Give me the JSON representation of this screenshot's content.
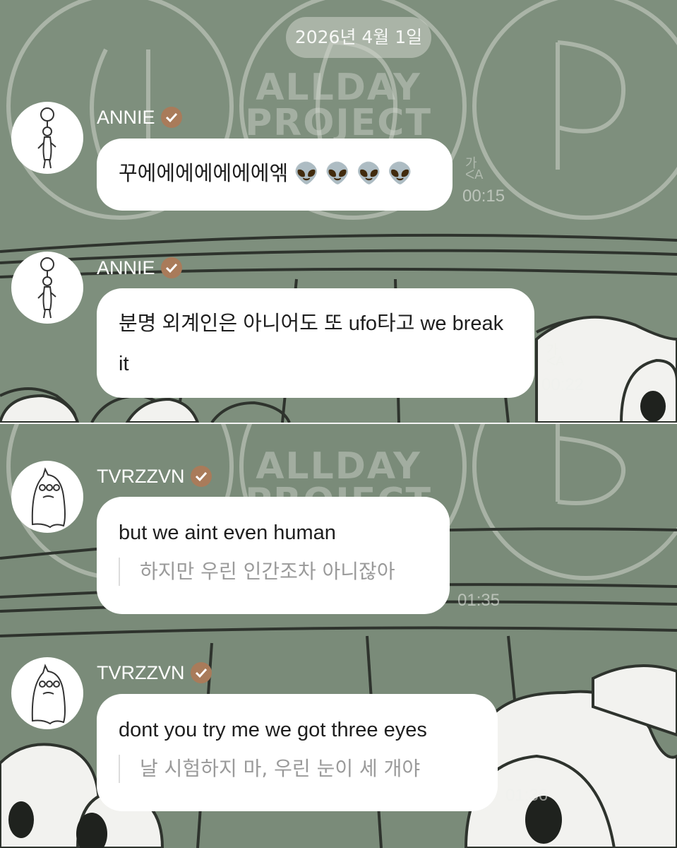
{
  "date": "2026년 4월 1일",
  "watermark": {
    "line1": "ALLDAY",
    "line2": "PROJECT"
  },
  "icons": {
    "verified": "verified-check-icon",
    "translate": "translate-icon"
  },
  "colors": {
    "background": "#7e8f7d",
    "bubble": "#ffffff",
    "verified_badge": "#a97b5a",
    "timestamp": "#e8ece6"
  },
  "messages": [
    {
      "sender": "ANNIE",
      "text": "꾸에에에에에에에엒 👽 👽 👽 👽",
      "translation": "",
      "time": "00:15"
    },
    {
      "sender": "ANNIE",
      "text": "분명 외계인은 아니어도 또 ufo타고 we break it",
      "translation": "",
      "time": "00:22"
    },
    {
      "sender": "TVRZZVN",
      "text": "but we aint even human",
      "translation": "하지만 우린 인간조차 아니잖아",
      "time": "01:35"
    },
    {
      "sender": "TVRZZVN",
      "text": "dont you try me we got three eyes",
      "translation": "날 시험하지 마, 우린 눈이 세 개야",
      "time": "01:36"
    }
  ]
}
